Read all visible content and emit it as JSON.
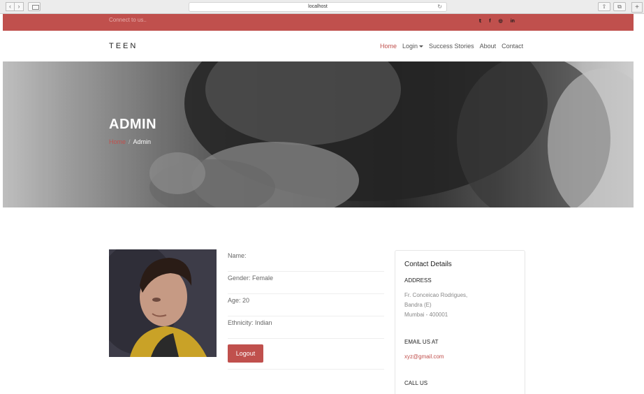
{
  "browser": {
    "url": "localhost"
  },
  "topbar": {
    "connect_text": "Connect to us..",
    "socials": [
      "twitter-icon",
      "facebook-icon",
      "instagram-icon",
      "linkedin-icon"
    ],
    "social_glyphs": [
      "𝕥",
      "f",
      "◎",
      "in"
    ]
  },
  "nav": {
    "logo": "TEEN",
    "items": [
      "Home",
      "Login",
      "Success Stories",
      "About",
      "Contact"
    ]
  },
  "hero": {
    "title": "ADMIN",
    "breadcrumb": {
      "home": "Home",
      "separator": "/",
      "current": "Admin"
    }
  },
  "profile": {
    "name": "Name:",
    "gender": "Gender: Female",
    "age": "Age: 20",
    "ethnicity": "Ethnicity: Indian",
    "logout_label": "Logout"
  },
  "contact": {
    "title": "Contact Details",
    "address_heading": "ADDRESS",
    "address_lines": [
      "Fr. Conceicao Rodrigues,",
      "Bandra (E)",
      "Mumbai - 400001"
    ],
    "email_heading": "EMAIL US AT",
    "email": "xyz@gmail.com",
    "call_heading": "CALL US"
  },
  "colors": {
    "accent": "#c0504d"
  }
}
